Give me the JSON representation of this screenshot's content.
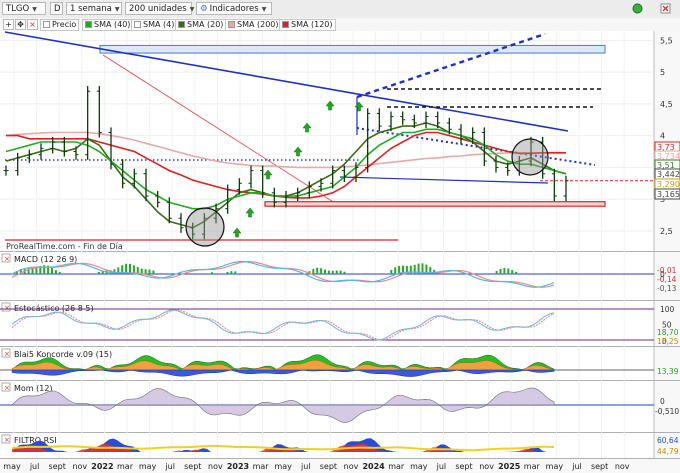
{
  "toolbar": {
    "symbol": "TLGO",
    "period_letter": "D",
    "timeframe": "1 semana",
    "units": "200 unidades",
    "indicators_label": "Indicadores"
  },
  "legend": [
    {
      "label": "Precio",
      "color": "#ffffff"
    },
    {
      "label": "SMA (40)",
      "color": "#22aa22"
    },
    {
      "label": "SMA (4)",
      "color": "#ffffff"
    },
    {
      "label": "SMA (20)",
      "color": "#3b6b1a"
    },
    {
      "label": "SMA (200)",
      "color": "#e8a8a8"
    },
    {
      "label": "SMA (120)",
      "color": "#dd2222"
    }
  ],
  "source_label": "ProRealTime.com - Fin de Día",
  "panels": {
    "macd": "MACD (12 26 9)",
    "stoch": "Estocástico (26 8 5)",
    "blai5": "Blai5 Koncorde v.09 (15)",
    "mom": "Mom (12)",
    "rsi": "FILTRO RSI"
  },
  "price_axis": [
    "5,5",
    "5",
    "4,5",
    "4",
    "3,5",
    "3",
    "2,5"
  ],
  "price_badges": [
    {
      "text": "3,73",
      "color": "#dd2222"
    },
    {
      "text": "3,734",
      "color": "#ff9a9a"
    },
    {
      "text": "3,51",
      "color": "#3a7a2a"
    },
    {
      "text": "3,442",
      "color": "#444444"
    },
    {
      "text": "3,290",
      "color": "#c8a000"
    },
    {
      "text": "3,165",
      "color": "#444444"
    }
  ],
  "macd_axis": {
    "zero": "0",
    "labels": [
      "-0,01",
      "-0,14",
      "-0,13"
    ]
  },
  "stoch_axis": {
    "top": "100",
    "mid": "50",
    "bottom": "0",
    "badges": [
      "18,70",
      "15,25"
    ]
  },
  "blai5_axis": {
    "badge": "13,39"
  },
  "mom_axis": {
    "zero": "0",
    "badge": "-0,510"
  },
  "rsi_axis": {
    "badges": [
      "60,64",
      "44,79"
    ]
  },
  "x_labels": [
    {
      "t": "may"
    },
    {
      "t": "jul"
    },
    {
      "t": "sept"
    },
    {
      "t": "nov"
    },
    {
      "t": "2022",
      "bold": true
    },
    {
      "t": "mar"
    },
    {
      "t": "may"
    },
    {
      "t": "jul"
    },
    {
      "t": "sept"
    },
    {
      "t": "nov"
    },
    {
      "t": "2023",
      "bold": true
    },
    {
      "t": "mar"
    },
    {
      "t": "may"
    },
    {
      "t": "jul"
    },
    {
      "t": "sept"
    },
    {
      "t": "nov"
    },
    {
      "t": "2024",
      "bold": true
    },
    {
      "t": "mar"
    },
    {
      "t": "may"
    },
    {
      "t": "jul"
    },
    {
      "t": "sept"
    },
    {
      "t": "nov"
    },
    {
      "t": "2025",
      "bold": true
    },
    {
      "t": "mar"
    },
    {
      "t": "may"
    },
    {
      "t": "jul"
    },
    {
      "t": "sept"
    },
    {
      "t": "nov"
    }
  ],
  "chart_data": {
    "type": "line",
    "price_range": [
      2.2,
      5.6
    ],
    "price_series": [
      {
        "d": "2021-05",
        "v": 3.45
      },
      {
        "d": "2021-06",
        "v": 3.65
      },
      {
        "d": "2021-07",
        "v": 3.7
      },
      {
        "d": "2021-08",
        "v": 3.8
      },
      {
        "d": "2021-09",
        "v": 3.9
      },
      {
        "d": "2021-10",
        "v": 3.75
      },
      {
        "d": "2021-11",
        "v": 3.7
      },
      {
        "d": "2021-12",
        "v": 4.7
      },
      {
        "d": "2022-01",
        "v": 4.05
      },
      {
        "d": "2022-02",
        "v": 3.55
      },
      {
        "d": "2022-03",
        "v": 3.25
      },
      {
        "d": "2022-04",
        "v": 3.4
      },
      {
        "d": "2022-05",
        "v": 3.05
      },
      {
        "d": "2022-06",
        "v": 2.95
      },
      {
        "d": "2022-07",
        "v": 2.7
      },
      {
        "d": "2022-08",
        "v": 2.55
      },
      {
        "d": "2022-09",
        "v": 2.45
      },
      {
        "d": "2022-10",
        "v": 2.7
      },
      {
        "d": "2022-11",
        "v": 2.85
      },
      {
        "d": "2022-12",
        "v": 3.15
      },
      {
        "d": "2023-01",
        "v": 3.25
      },
      {
        "d": "2023-02",
        "v": 3.45
      },
      {
        "d": "2023-03",
        "v": 3.1
      },
      {
        "d": "2023-04",
        "v": 2.95
      },
      {
        "d": "2023-05",
        "v": 3.05
      },
      {
        "d": "2023-06",
        "v": 3.1
      },
      {
        "d": "2023-07",
        "v": 3.2
      },
      {
        "d": "2023-08",
        "v": 3.25
      },
      {
        "d": "2023-09",
        "v": 3.45
      },
      {
        "d": "2023-10",
        "v": 3.35
      },
      {
        "d": "2023-11",
        "v": 3.5
      },
      {
        "d": "2023-12",
        "v": 4.35
      },
      {
        "d": "2024-01",
        "v": 4.15
      },
      {
        "d": "2024-02",
        "v": 4.3
      },
      {
        "d": "2024-03",
        "v": 4.25
      },
      {
        "d": "2024-04",
        "v": 4.2
      },
      {
        "d": "2024-05",
        "v": 4.3
      },
      {
        "d": "2024-06",
        "v": 4.2
      },
      {
        "d": "2024-07",
        "v": 4.1
      },
      {
        "d": "2024-08",
        "v": 3.95
      },
      {
        "d": "2024-09",
        "v": 4.05
      },
      {
        "d": "2024-10",
        "v": 3.6
      },
      {
        "d": "2024-11",
        "v": 3.5
      },
      {
        "d": "2024-12",
        "v": 3.45
      },
      {
        "d": "2025-01",
        "v": 3.6
      },
      {
        "d": "2025-02",
        "v": 3.9
      },
      {
        "d": "2025-03",
        "v": 3.4
      },
      {
        "d": "2025-04",
        "v": 3.05
      },
      {
        "d": "2025-05",
        "v": 3.29
      }
    ],
    "moving_averages": [
      {
        "name": "SMA (40)",
        "color": "#22aa22",
        "values": [
          3.75,
          3.8,
          3.85,
          3.9,
          3.9,
          3.9,
          3.9,
          3.85,
          3.75,
          3.6,
          3.45,
          3.3,
          3.15,
          3.05,
          2.95,
          2.9,
          2.85,
          2.85,
          2.9,
          3.0,
          3.05,
          3.1,
          3.1,
          3.05,
          3.05,
          3.05,
          3.1,
          3.15,
          3.2,
          3.35,
          3.5,
          3.7,
          3.85,
          3.95,
          4.05,
          4.05,
          4.1,
          4.1,
          4.05,
          4.0,
          3.95,
          3.85,
          3.7,
          3.6,
          3.55,
          3.55,
          3.5,
          3.45,
          3.4
        ]
      },
      {
        "name": "SMA (20)",
        "color": "#3b6b1a",
        "values": [
          3.6,
          3.65,
          3.7,
          3.75,
          3.8,
          3.75,
          3.8,
          3.95,
          3.85,
          3.6,
          3.35,
          3.2,
          3.0,
          2.8,
          2.65,
          2.6,
          2.55,
          2.65,
          2.8,
          2.95,
          3.1,
          3.15,
          3.1,
          3.05,
          3.05,
          3.1,
          3.2,
          3.3,
          3.4,
          3.55,
          3.75,
          3.95,
          4.05,
          4.1,
          4.15,
          4.15,
          4.2,
          4.15,
          4.05,
          4.0,
          3.9,
          3.75,
          3.6,
          3.55,
          3.6,
          3.65,
          3.55,
          3.45,
          3.4
        ]
      },
      {
        "name": "SMA (120)",
        "color": "#dd2222",
        "values": [
          4.0,
          4.0,
          3.95,
          3.95,
          3.95,
          3.95,
          3.95,
          3.95,
          3.9,
          3.85,
          3.8,
          3.75,
          3.65,
          3.55,
          3.45,
          3.38,
          3.3,
          3.25,
          3.2,
          3.15,
          3.12,
          3.1,
          3.08,
          3.05,
          3.03,
          3.02,
          3.02,
          3.05,
          3.1,
          3.2,
          3.35,
          3.5,
          3.65,
          3.8,
          3.9,
          4.0,
          4.05,
          4.05,
          4.0,
          3.95,
          3.9,
          3.85,
          3.8,
          3.75,
          3.72,
          3.72,
          3.73,
          3.73,
          3.73
        ]
      },
      {
        "name": "SMA (200)",
        "color": "#e8a8a8",
        "values": [
          4.0,
          4.02,
          4.03,
          4.04,
          4.05,
          4.05,
          4.05,
          4.05,
          4.03,
          4.0,
          3.97,
          3.93,
          3.88,
          3.83,
          3.78,
          3.73,
          3.68,
          3.64,
          3.6,
          3.57,
          3.55,
          3.53,
          3.52,
          3.52,
          3.51,
          3.5,
          3.5,
          3.5,
          3.5,
          3.51,
          3.52,
          3.54,
          3.56,
          3.58,
          3.6,
          3.62,
          3.64,
          3.65,
          3.67,
          3.68,
          3.7,
          3.71,
          3.72,
          3.73,
          3.73,
          3.73,
          3.73,
          3.734,
          3.734
        ]
      }
    ],
    "annotations": {
      "support_level": 2.93,
      "low_support": 2.4,
      "red_dashed_level": 3.29,
      "black_dashed_levels": [
        4.8,
        4.5
      ]
    }
  }
}
